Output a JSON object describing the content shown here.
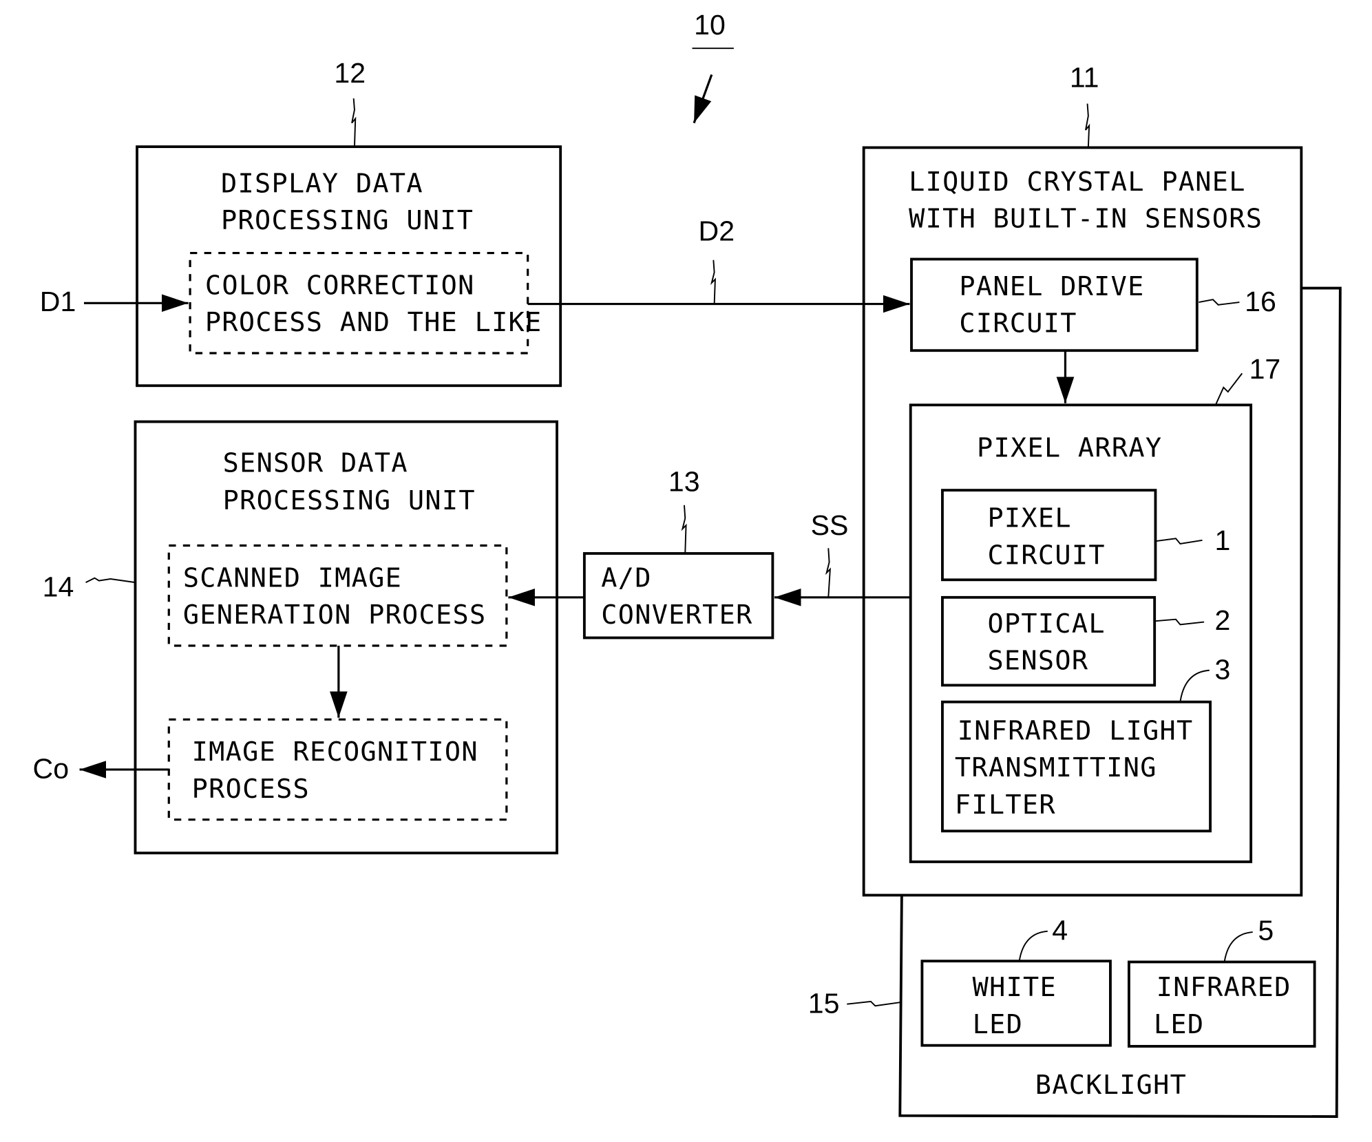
{
  "figure_ref": "10",
  "blocks": {
    "display_unit": {
      "ref": "12",
      "title": [
        "DISPLAY DATA",
        "PROCESSING UNIT"
      ],
      "sub": [
        "COLOR CORRECTION",
        "PROCESS AND THE LIKE"
      ]
    },
    "sensor_unit": {
      "ref": "14",
      "title": [
        "SENSOR DATA",
        "PROCESSING UNIT"
      ],
      "sub1": [
        "SCANNED IMAGE",
        "GENERATION PROCESS"
      ],
      "sub2": [
        "IMAGE RECOGNITION",
        "PROCESS"
      ]
    },
    "adc": {
      "ref": "13",
      "label": [
        "A/D",
        "CONVERTER"
      ]
    },
    "lcd_panel": {
      "ref": "11",
      "title": [
        "LIQUID CRYSTAL PANEL",
        "WITH BUILT-IN SENSORS"
      ]
    },
    "panel_drive": {
      "ref": "16",
      "label": [
        "PANEL DRIVE",
        "CIRCUIT"
      ]
    },
    "pixel_array": {
      "ref": "17",
      "title": "PIXEL ARRAY"
    },
    "pixel_circuit": {
      "ref": "1",
      "label": [
        "PIXEL",
        "CIRCUIT"
      ]
    },
    "optical_sensor": {
      "ref": "2",
      "label": [
        "OPTICAL",
        "SENSOR"
      ]
    },
    "ir_filter": {
      "ref": "3",
      "label": [
        "INFRARED LIGHT",
        "TRANSMITTING",
        "FILTER"
      ]
    },
    "backlight": {
      "ref": "15",
      "title": "BACKLIGHT"
    },
    "white_led": {
      "ref": "4",
      "label": [
        "WHITE",
        "LED"
      ]
    },
    "ir_led": {
      "ref": "5",
      "label": [
        "INFRARED",
        "LED"
      ]
    }
  },
  "signals": {
    "d1": "D1",
    "d2": "D2",
    "ss": "SS",
    "co": "Co"
  }
}
